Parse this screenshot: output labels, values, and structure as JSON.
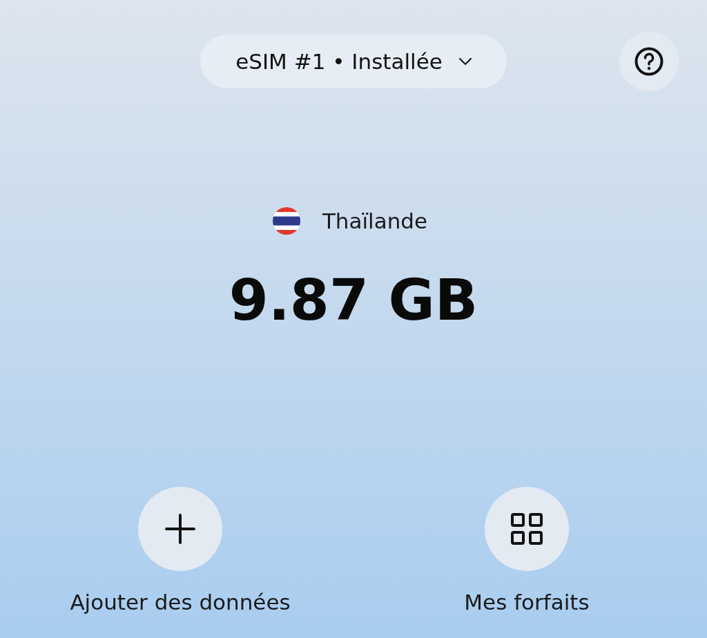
{
  "sim_selector": {
    "label": "eSIM #1 • Installée"
  },
  "country": {
    "name": "Thaïlande"
  },
  "data_remaining": "9.87 GB",
  "actions": [
    {
      "kind": "add",
      "label": "Ajouter des données"
    },
    {
      "kind": "plans",
      "label": "Mes forfaits"
    }
  ]
}
